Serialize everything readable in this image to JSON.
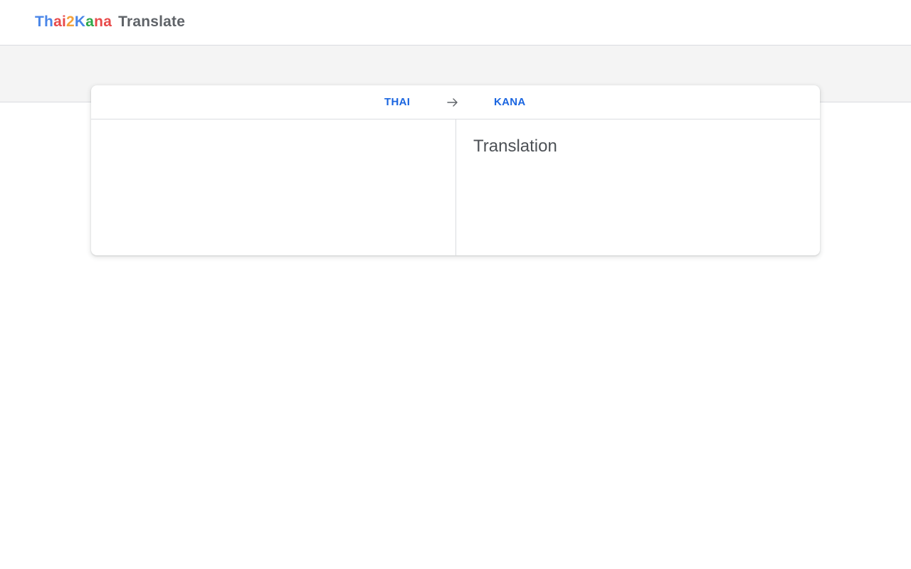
{
  "header": {
    "brand_letters": [
      {
        "char": "T",
        "color": "#4a86e8"
      },
      {
        "char": "h",
        "color": "#4a86e8"
      },
      {
        "char": "a",
        "color": "#e84a4a"
      },
      {
        "char": "i",
        "color": "#e84a4a"
      },
      {
        "char": "2",
        "color": "#f4a23b"
      },
      {
        "char": "K",
        "color": "#4a86e8"
      },
      {
        "char": "a",
        "color": "#2ea84a"
      },
      {
        "char": "n",
        "color": "#e84a4a"
      },
      {
        "char": "a",
        "color": "#e84a4a"
      }
    ],
    "product_label": "Translate"
  },
  "translator": {
    "source_language": "THAI",
    "target_language": "KANA",
    "swap_icon": "arrow-right-icon",
    "source_text": "",
    "translation_placeholder": "Translation",
    "accent_color": "#1a65e0"
  }
}
